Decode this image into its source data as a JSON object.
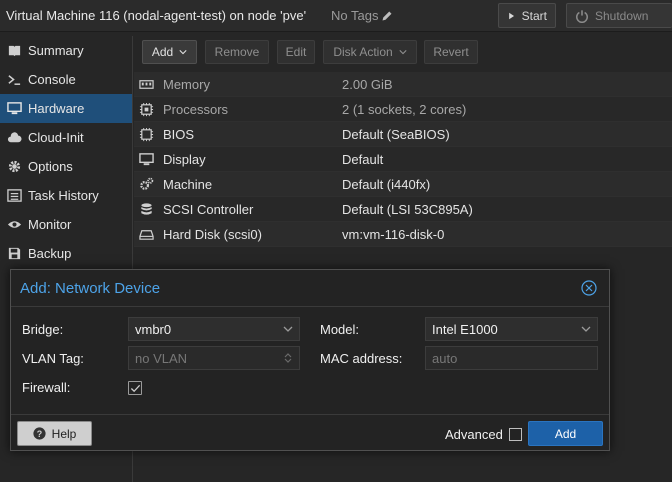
{
  "titlebar": {
    "title": "Virtual Machine 116 (nodal-agent-test) on node 'pve'",
    "tags_label": "No Tags",
    "start_label": "Start",
    "shutdown_label": "Shutdown"
  },
  "sidebar": {
    "items": [
      {
        "label": "Summary",
        "icon": "book-icon"
      },
      {
        "label": "Console",
        "icon": "terminal-icon"
      },
      {
        "label": "Hardware",
        "icon": "desktop-icon"
      },
      {
        "label": "Cloud-Init",
        "icon": "cloud-icon"
      },
      {
        "label": "Options",
        "icon": "gear-icon"
      },
      {
        "label": "Task History",
        "icon": "list-icon"
      },
      {
        "label": "Monitor",
        "icon": "eye-icon"
      },
      {
        "label": "Backup",
        "icon": "floppy-icon"
      }
    ],
    "active": "Hardware"
  },
  "toolbar": {
    "add_label": "Add",
    "remove_label": "Remove",
    "edit_label": "Edit",
    "disk_action_label": "Disk Action",
    "revert_label": "Revert"
  },
  "hardware": {
    "rows": [
      {
        "name": "Memory",
        "value": "2.00 GiB",
        "icon": "memory-icon"
      },
      {
        "name": "Processors",
        "value": "2 (1 sockets, 2 cores)",
        "icon": "cpu-icon"
      },
      {
        "name": "BIOS",
        "value": "Default (SeaBIOS)",
        "icon": "chip-icon"
      },
      {
        "name": "Display",
        "value": "Default",
        "icon": "desktop-icon"
      },
      {
        "name": "Machine",
        "value": "Default (i440fx)",
        "icon": "cogs-icon"
      },
      {
        "name": "SCSI Controller",
        "value": "Default (LSI 53C895A)",
        "icon": "database-icon"
      },
      {
        "name": "Hard Disk (scsi0)",
        "value": "vm:vm-116-disk-0",
        "icon": "hdd-icon"
      }
    ]
  },
  "dialog": {
    "title": "Add: Network Device",
    "bridge_label": "Bridge:",
    "bridge_value": "vmbr0",
    "vlan_label": "VLAN Tag:",
    "vlan_placeholder": "no VLAN",
    "firewall_label": "Firewall:",
    "firewall_checked": true,
    "model_label": "Model:",
    "model_value": "Intel E1000",
    "mac_label": "MAC address:",
    "mac_placeholder": "auto",
    "help_label": "Help",
    "advanced_label": "Advanced",
    "advanced_checked": false,
    "add_label": "Add"
  },
  "colors": {
    "accent": "#1d61a8",
    "title_blue": "#4da3e8",
    "active_nav": "#1f4f7a"
  }
}
